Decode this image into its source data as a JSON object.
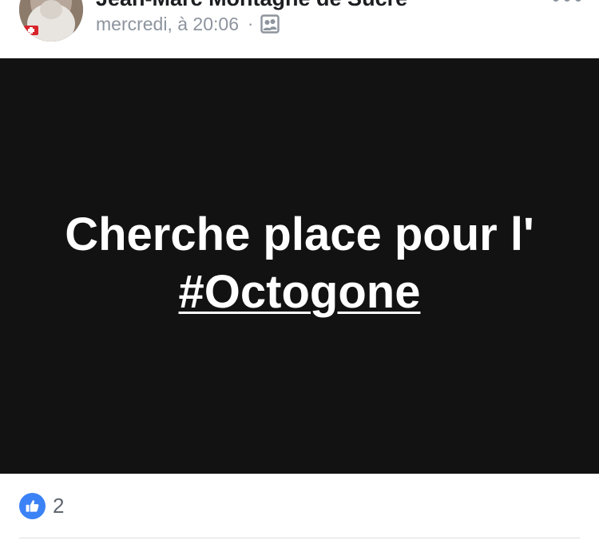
{
  "post": {
    "author": "Jean-Marc Montagne de Sucre",
    "timestamp": "mercredi, à 20:06",
    "separator": "·",
    "audience_icon": "friends-audience-icon",
    "more_icon": "more-options-icon",
    "content": {
      "background": "#121212",
      "text_line1": "Cherche place pour l'",
      "hashtag": "#Octogone"
    },
    "reactions": {
      "icon": "like-icon",
      "count": "2",
      "color": "#3b82f6"
    }
  }
}
